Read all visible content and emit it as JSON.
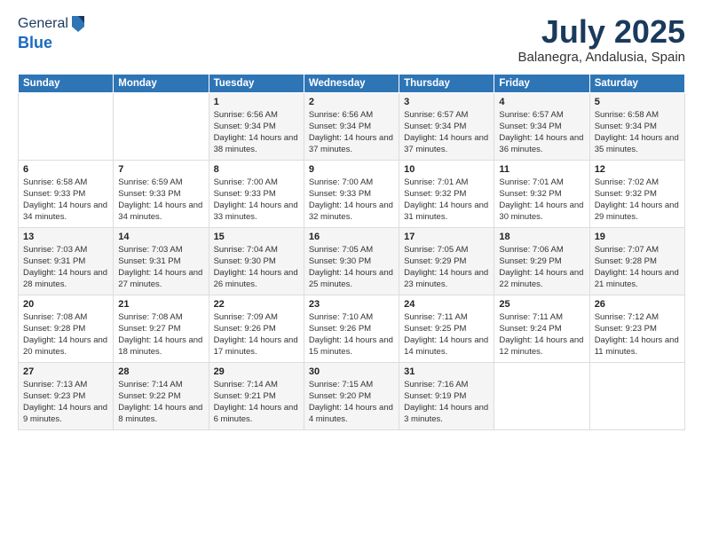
{
  "header": {
    "logo_line1": "General",
    "logo_line2": "Blue",
    "title": "July 2025",
    "subtitle": "Balanegra, Andalusia, Spain"
  },
  "weekdays": [
    "Sunday",
    "Monday",
    "Tuesday",
    "Wednesday",
    "Thursday",
    "Friday",
    "Saturday"
  ],
  "weeks": [
    [
      {
        "day": "",
        "content": ""
      },
      {
        "day": "",
        "content": ""
      },
      {
        "day": "1",
        "content": "Sunrise: 6:56 AM\nSunset: 9:34 PM\nDaylight: 14 hours and 38 minutes."
      },
      {
        "day": "2",
        "content": "Sunrise: 6:56 AM\nSunset: 9:34 PM\nDaylight: 14 hours and 37 minutes."
      },
      {
        "day": "3",
        "content": "Sunrise: 6:57 AM\nSunset: 9:34 PM\nDaylight: 14 hours and 37 minutes."
      },
      {
        "day": "4",
        "content": "Sunrise: 6:57 AM\nSunset: 9:34 PM\nDaylight: 14 hours and 36 minutes."
      },
      {
        "day": "5",
        "content": "Sunrise: 6:58 AM\nSunset: 9:34 PM\nDaylight: 14 hours and 35 minutes."
      }
    ],
    [
      {
        "day": "6",
        "content": "Sunrise: 6:58 AM\nSunset: 9:33 PM\nDaylight: 14 hours and 34 minutes."
      },
      {
        "day": "7",
        "content": "Sunrise: 6:59 AM\nSunset: 9:33 PM\nDaylight: 14 hours and 34 minutes."
      },
      {
        "day": "8",
        "content": "Sunrise: 7:00 AM\nSunset: 9:33 PM\nDaylight: 14 hours and 33 minutes."
      },
      {
        "day": "9",
        "content": "Sunrise: 7:00 AM\nSunset: 9:33 PM\nDaylight: 14 hours and 32 minutes."
      },
      {
        "day": "10",
        "content": "Sunrise: 7:01 AM\nSunset: 9:32 PM\nDaylight: 14 hours and 31 minutes."
      },
      {
        "day": "11",
        "content": "Sunrise: 7:01 AM\nSunset: 9:32 PM\nDaylight: 14 hours and 30 minutes."
      },
      {
        "day": "12",
        "content": "Sunrise: 7:02 AM\nSunset: 9:32 PM\nDaylight: 14 hours and 29 minutes."
      }
    ],
    [
      {
        "day": "13",
        "content": "Sunrise: 7:03 AM\nSunset: 9:31 PM\nDaylight: 14 hours and 28 minutes."
      },
      {
        "day": "14",
        "content": "Sunrise: 7:03 AM\nSunset: 9:31 PM\nDaylight: 14 hours and 27 minutes."
      },
      {
        "day": "15",
        "content": "Sunrise: 7:04 AM\nSunset: 9:30 PM\nDaylight: 14 hours and 26 minutes."
      },
      {
        "day": "16",
        "content": "Sunrise: 7:05 AM\nSunset: 9:30 PM\nDaylight: 14 hours and 25 minutes."
      },
      {
        "day": "17",
        "content": "Sunrise: 7:05 AM\nSunset: 9:29 PM\nDaylight: 14 hours and 23 minutes."
      },
      {
        "day": "18",
        "content": "Sunrise: 7:06 AM\nSunset: 9:29 PM\nDaylight: 14 hours and 22 minutes."
      },
      {
        "day": "19",
        "content": "Sunrise: 7:07 AM\nSunset: 9:28 PM\nDaylight: 14 hours and 21 minutes."
      }
    ],
    [
      {
        "day": "20",
        "content": "Sunrise: 7:08 AM\nSunset: 9:28 PM\nDaylight: 14 hours and 20 minutes."
      },
      {
        "day": "21",
        "content": "Sunrise: 7:08 AM\nSunset: 9:27 PM\nDaylight: 14 hours and 18 minutes."
      },
      {
        "day": "22",
        "content": "Sunrise: 7:09 AM\nSunset: 9:26 PM\nDaylight: 14 hours and 17 minutes."
      },
      {
        "day": "23",
        "content": "Sunrise: 7:10 AM\nSunset: 9:26 PM\nDaylight: 14 hours and 15 minutes."
      },
      {
        "day": "24",
        "content": "Sunrise: 7:11 AM\nSunset: 9:25 PM\nDaylight: 14 hours and 14 minutes."
      },
      {
        "day": "25",
        "content": "Sunrise: 7:11 AM\nSunset: 9:24 PM\nDaylight: 14 hours and 12 minutes."
      },
      {
        "day": "26",
        "content": "Sunrise: 7:12 AM\nSunset: 9:23 PM\nDaylight: 14 hours and 11 minutes."
      }
    ],
    [
      {
        "day": "27",
        "content": "Sunrise: 7:13 AM\nSunset: 9:23 PM\nDaylight: 14 hours and 9 minutes."
      },
      {
        "day": "28",
        "content": "Sunrise: 7:14 AM\nSunset: 9:22 PM\nDaylight: 14 hours and 8 minutes."
      },
      {
        "day": "29",
        "content": "Sunrise: 7:14 AM\nSunset: 9:21 PM\nDaylight: 14 hours and 6 minutes."
      },
      {
        "day": "30",
        "content": "Sunrise: 7:15 AM\nSunset: 9:20 PM\nDaylight: 14 hours and 4 minutes."
      },
      {
        "day": "31",
        "content": "Sunrise: 7:16 AM\nSunset: 9:19 PM\nDaylight: 14 hours and 3 minutes."
      },
      {
        "day": "",
        "content": ""
      },
      {
        "day": "",
        "content": ""
      }
    ]
  ]
}
